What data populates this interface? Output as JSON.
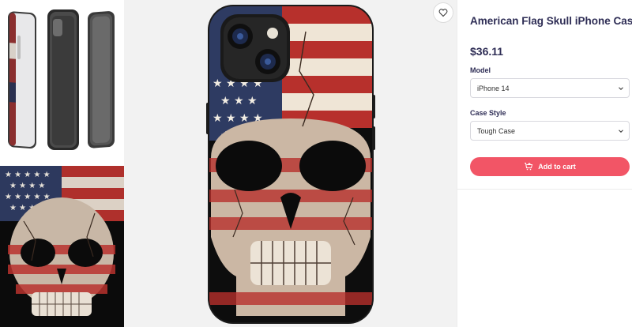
{
  "product": {
    "title": "American Flag Skull iPhone Case",
    "price": "$36.11"
  },
  "options": {
    "model_label": "Model",
    "model_value": "iPhone 14",
    "style_label": "Case Style",
    "style_value": "Tough Case"
  },
  "actions": {
    "add_to_cart": "Add to cart"
  },
  "icons": {
    "favorite": "heart-icon",
    "dropdown": "chevron-down-icon",
    "cart": "cart-icon"
  },
  "colors": {
    "accent": "#f25566",
    "title": "#2e2d55"
  }
}
